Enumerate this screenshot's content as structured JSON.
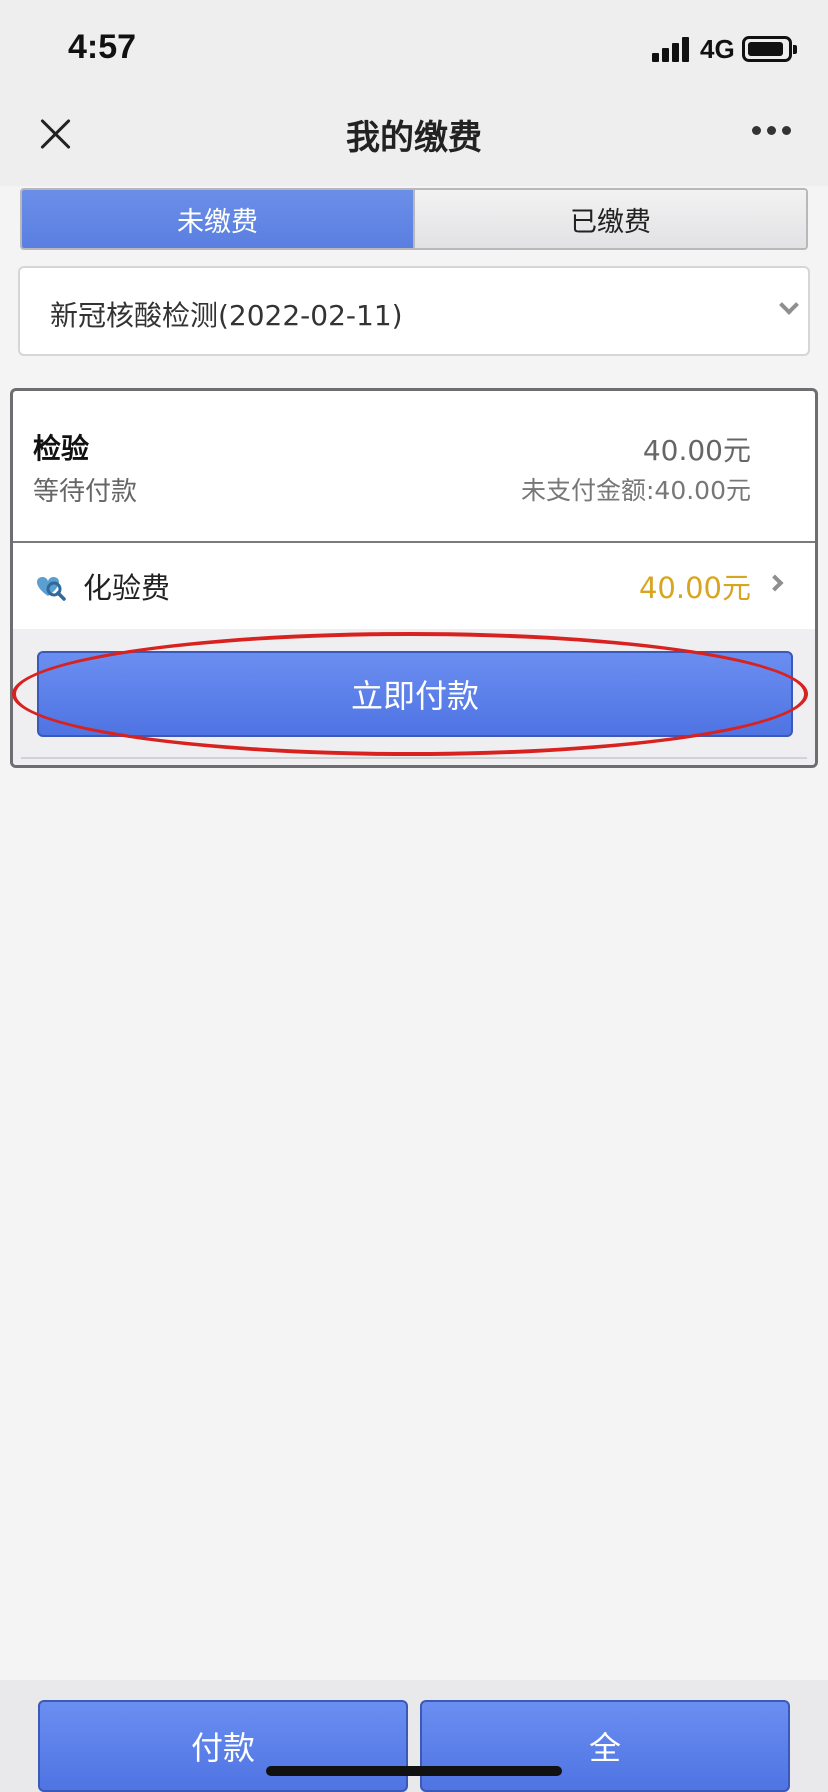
{
  "status_bar": {
    "time": "4:57",
    "network": "4G"
  },
  "nav": {
    "title": "我的缴费"
  },
  "tabs": [
    {
      "label": "未缴费",
      "active": true
    },
    {
      "label": "已缴费",
      "active": false
    }
  ],
  "selector": {
    "selected": "新冠核酸检测(2022-02-11)"
  },
  "card": {
    "type": "检验",
    "status": "等待付款",
    "amount": "40.00元",
    "unpaid": "未支付金额:40.00元",
    "fee": {
      "name": "化验费",
      "amount": "40.00元"
    },
    "pay_label": "立即付款"
  },
  "bottom": {
    "left_label": "付款",
    "right_label": "全"
  },
  "colors": {
    "accent": "#5a7fe0",
    "fee_amount": "#d8a520",
    "highlight": "#d8221f"
  }
}
